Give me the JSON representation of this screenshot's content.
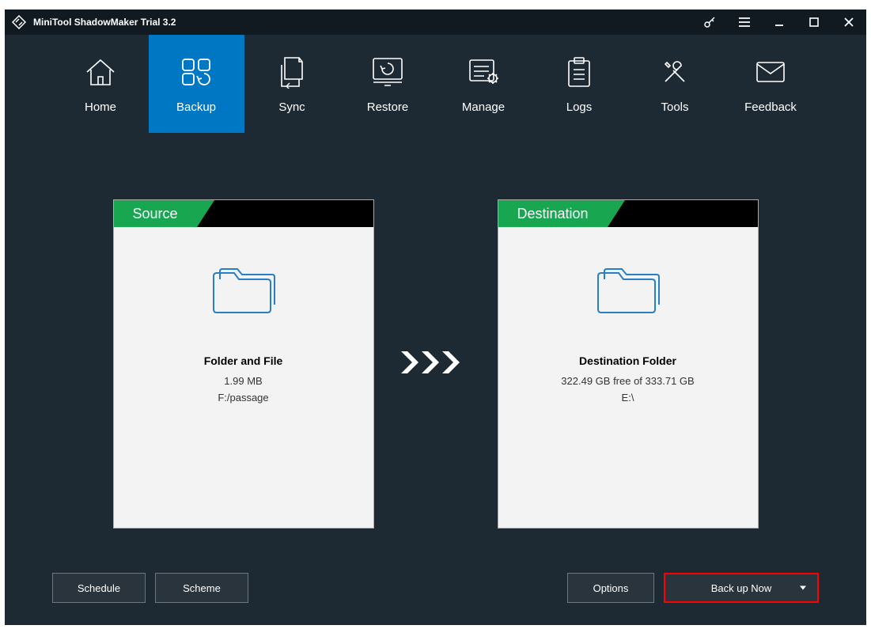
{
  "titlebar": {
    "title": "MiniTool ShadowMaker Trial 3.2"
  },
  "nav": {
    "items": [
      {
        "label": "Home"
      },
      {
        "label": "Backup"
      },
      {
        "label": "Sync"
      },
      {
        "label": "Restore"
      },
      {
        "label": "Manage"
      },
      {
        "label": "Logs"
      },
      {
        "label": "Tools"
      },
      {
        "label": "Feedback"
      }
    ]
  },
  "source": {
    "header": "Source",
    "title": "Folder and File",
    "size": "1.99 MB",
    "path": "F:/passage"
  },
  "destination": {
    "header": "Destination",
    "title": "Destination Folder",
    "free": "322.49 GB free of 333.71 GB",
    "path": "E:\\"
  },
  "buttons": {
    "schedule": "Schedule",
    "scheme": "Scheme",
    "options": "Options",
    "backup_now": "Back up Now"
  }
}
